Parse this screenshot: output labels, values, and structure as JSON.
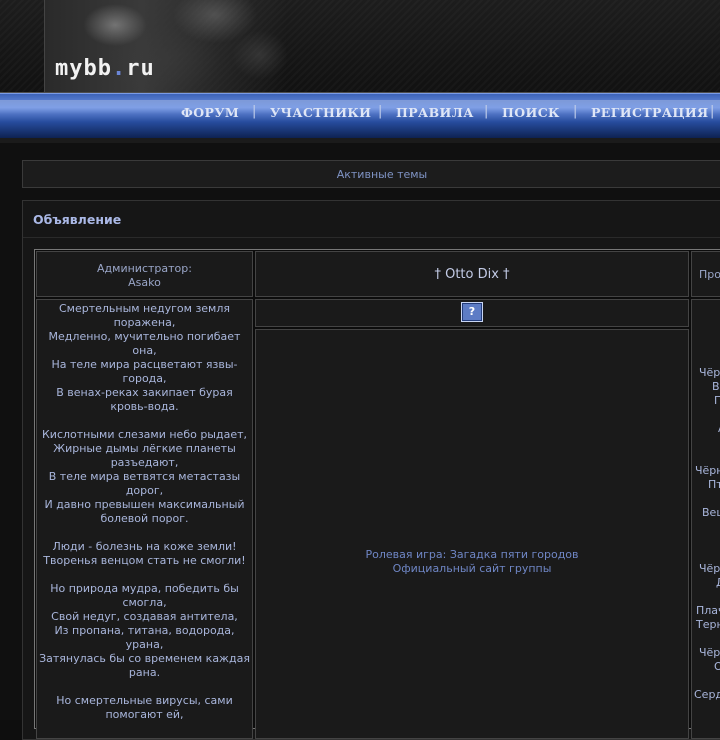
{
  "header": {
    "logo_main": "mybb",
    "logo_dot": ".",
    "logo_tld": "ru"
  },
  "nav": {
    "items": [
      "ФОРУМ",
      "УЧАСТНИКИ",
      "ПРАВИЛА",
      "ПОИСК",
      "РЕГИСТРАЦИЯ"
    ],
    "separator": "|"
  },
  "active_topics": "Активные темы",
  "announcement": {
    "heading": "Объявление",
    "admin_label": "Администратор:",
    "admin_name": "Asako",
    "title": "† Otto Dix †",
    "right_header_fragment": "Про",
    "help_icon": "?",
    "poem": [
      "Смертельным недугом земля",
      "поражена,",
      "Медленно, мучительно погибает",
      "она,",
      "На теле мира расцветают язвы-",
      "города,",
      "В венах-реках закипает бурая",
      "кровь-вода.",
      "",
      "Кислотными слезами небо рыдает,",
      "Жирные дымы лёгкие планеты",
      "разъедают,",
      "В теле мира ветвятся метастазы",
      "дорог,",
      "И давно превышен максимальный",
      "болевой порог.",
      "",
      "Люди - болезнь на коже земли!",
      "Творенья венцом стать не смогли!",
      "",
      "Но природа мудра, победить бы",
      "смогла,",
      "Свой недуг, создавая антитела,",
      "Из пропана, титана, водорода,",
      "урана,",
      "Затянулась бы со временем каждая",
      "рана.",
      "",
      "Но смертельные вирусы, сами",
      "помогают ей,"
    ],
    "links": [
      "Ролевая игра: Загадка пяти городов",
      "Официальный сайт группы"
    ],
    "right_fragments": [
      "Чёр",
      "В",
      "П",
      "А",
      "Чёрн",
      "Пт",
      "Вещ",
      "Чёр",
      "Д",
      "Плач",
      "Терн",
      "Чёр",
      "О",
      "Серд"
    ]
  },
  "colors": {
    "nav_blue": "#3c63b8",
    "link": "#6f86c5",
    "text": "#a9b6dc"
  }
}
